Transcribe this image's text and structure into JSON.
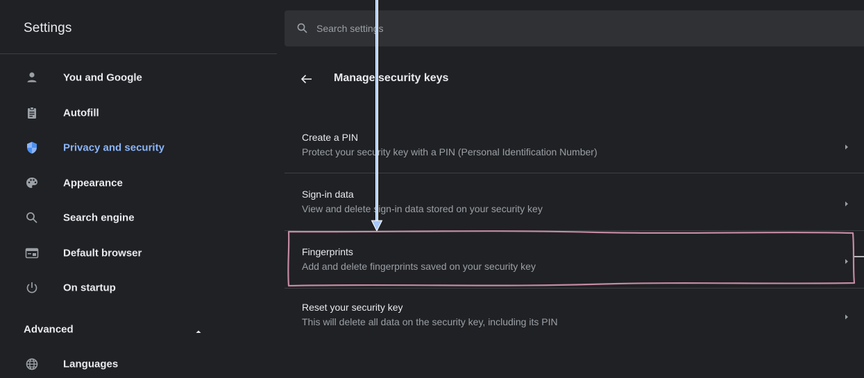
{
  "sidebar": {
    "title": "Settings",
    "items": [
      {
        "label": "You and Google",
        "icon": "person-icon"
      },
      {
        "label": "Autofill",
        "icon": "clipboard-icon"
      },
      {
        "label": "Privacy and security",
        "icon": "shield-icon",
        "active": true
      },
      {
        "label": "Appearance",
        "icon": "palette-icon"
      },
      {
        "label": "Search engine",
        "icon": "search-icon"
      },
      {
        "label": "Default browser",
        "icon": "browser-window-icon"
      },
      {
        "label": "On startup",
        "icon": "power-icon"
      }
    ],
    "advanced": {
      "label": "Advanced",
      "expanded": true,
      "icon": "caret-up-icon"
    },
    "advanced_items": [
      {
        "label": "Languages",
        "icon": "globe-icon"
      }
    ]
  },
  "search": {
    "placeholder": "Search settings",
    "icon": "search-icon"
  },
  "main": {
    "title": "Manage security keys",
    "back_icon": "back-arrow-icon",
    "items": [
      {
        "title": "Create a PIN",
        "description": "Protect your security key with a PIN (Personal Identification Number)",
        "icon": "chevron-right-icon"
      },
      {
        "title": "Sign-in data",
        "description": "View and delete sign-in data stored on your security key",
        "icon": "chevron-right-icon"
      },
      {
        "title": "Fingerprints",
        "description": "Add and delete fingerprints saved on your security key",
        "icon": "chevron-right-icon",
        "highlighted": true
      },
      {
        "title": "Reset your security key",
        "description": "This will delete all data on the security key, including its PIN",
        "icon": "chevron-right-icon"
      }
    ]
  },
  "colors": {
    "background": "#202124",
    "search_background": "#303134",
    "divider": "#3c4043",
    "text_primary": "#e8eaed",
    "text_secondary": "#9aa0a6",
    "accent": "#8ab4f8",
    "annotation_arrow": "#a8c7fa",
    "annotation_outline": "#c48aa3"
  }
}
